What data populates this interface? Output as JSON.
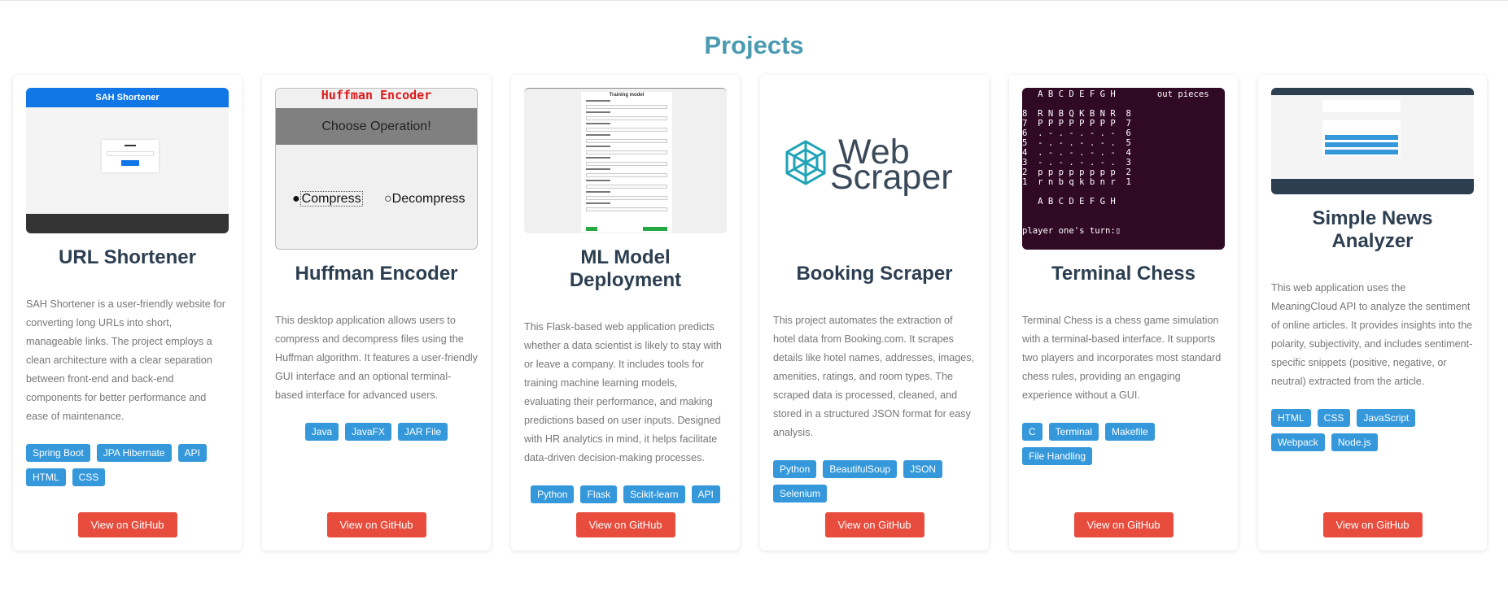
{
  "section_title": "Projects",
  "button_label": "View on GitHub",
  "thumbs": {
    "url": {
      "header": "SAH Shortener",
      "box_title": "Short Url"
    },
    "huffman": {
      "header": "Huffman Encoder",
      "operation": "Choose Operation!",
      "opt1": "Compress",
      "opt2": "Decompress"
    },
    "ml": {
      "title": "Training model"
    },
    "scraper": {
      "line1": "Web",
      "line2": "Scraper"
    },
    "chess": {
      "lines": [
        "   A B C D E F G H        out pieces",
        "",
        "8  R N B Q K B N R  8",
        "7  P P P P P P P P  7",
        "6  . - . - . - . -  6",
        "5  - . - . - . - .  5",
        "4  . - . - . - . -  4",
        "3  - . - . - . - .  3",
        "2  p p p p p p p p  2",
        "1  r n b q k b n r  1",
        "",
        "   A B C D E F G H",
        "",
        "",
        "player one's turn:▯"
      ]
    }
  },
  "projects": [
    {
      "title": "URL Shortener",
      "description": "SAH Shortener is a user-friendly website for converting long URLs into short, manageable links. The project employs a clean architecture with a clear separation between front-end and back-end components for better performance and ease of maintenance.",
      "tags": [
        "Spring Boot",
        "JPA Hibernate",
        "API",
        "HTML",
        "CSS"
      ]
    },
    {
      "title": "Huffman Encoder",
      "description": "This desktop application allows users to compress and decompress files using the Huffman algorithm. It features a user-friendly GUI interface and an optional terminal-based interface for advanced users.",
      "tags": [
        "Java",
        "JavaFX",
        "JAR File"
      ]
    },
    {
      "title": "ML Model Deployment",
      "description": "This Flask-based web application predicts whether a data scientist is likely to stay with or leave a company. It includes tools for training machine learning models, evaluating their performance, and making predictions based on user inputs. Designed with HR analytics in mind, it helps facilitate data-driven decision-making processes.",
      "tags": [
        "Python",
        "Flask",
        "Scikit-learn",
        "API"
      ]
    },
    {
      "title": "Booking Scraper",
      "description": "This project automates the extraction of hotel data from Booking.com. It scrapes details like hotel names, addresses, images, amenities, ratings, and room types. The scraped data is processed, cleaned, and stored in a structured JSON format for easy analysis.",
      "tags": [
        "Python",
        "BeautifulSoup",
        "JSON",
        "Selenium"
      ]
    },
    {
      "title": "Terminal Chess",
      "description": "Terminal Chess is a chess game simulation with a terminal-based interface. It supports two players and incorporates most standard chess rules, providing an engaging experience without a GUI.",
      "tags": [
        "C",
        "Terminal",
        "Makefile",
        "File Handling"
      ]
    },
    {
      "title": "Simple News Analyzer",
      "description": "This web application uses the MeaningCloud API to analyze the sentiment of online articles. It provides insights into the polarity, subjectivity, and includes sentiment-specific snippets (positive, negative, or neutral) extracted from the article.",
      "tags": [
        "HTML",
        "CSS",
        "JavaScript",
        "Webpack",
        "Node.js"
      ]
    }
  ]
}
